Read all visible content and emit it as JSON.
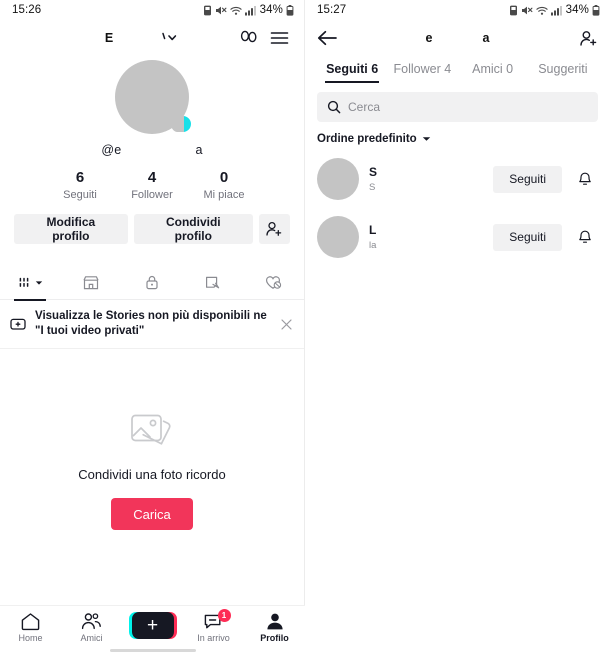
{
  "left": {
    "status": {
      "time": "15:26",
      "battery_percent": "34%"
    },
    "header": {
      "title": "E",
      "caret_icon": "chevron-down-icon",
      "figures_icon": "figures-icon",
      "menu_icon": "hamburger-menu-icon"
    },
    "profile": {
      "handle_prefix": "@e",
      "handle_suffix": "a",
      "avatar_badge_color": "#18e0e8"
    },
    "stats": [
      {
        "value": "6",
        "label": "Seguiti"
      },
      {
        "value": "4",
        "label": "Follower"
      },
      {
        "value": "0",
        "label": "Mi piace"
      }
    ],
    "actions": {
      "edit_label": "Modifica profilo",
      "share_label": "Condividi profilo",
      "add_friend_icon": "add-person-icon"
    },
    "tabs": [
      {
        "icon": "grid-posts-icon",
        "active": true,
        "has_caret": true
      },
      {
        "icon": "storefront-icon",
        "active": false,
        "has_caret": false
      },
      {
        "icon": "lock-private-icon",
        "active": false,
        "has_caret": false
      },
      {
        "icon": "repost-icon",
        "active": false,
        "has_caret": false
      },
      {
        "icon": "heart-hidden-icon",
        "active": false,
        "has_caret": false
      }
    ],
    "tip": {
      "icon": "stories-add-icon",
      "text": "Visualizza le Stories non più disponibili ne \"I tuoi video privati\"",
      "close_icon": "close-icon"
    },
    "empty": {
      "icon": "photo-stack-icon",
      "title": "Condividi una foto ricordo",
      "button_label": "Carica",
      "button_color": "#f2355a"
    },
    "bottomnav": [
      {
        "icon": "home-icon",
        "label": "Home",
        "active": false
      },
      {
        "icon": "friends-icon",
        "label": "Amici",
        "active": false
      },
      {
        "icon": "plus-icon",
        "label": "",
        "active": false
      },
      {
        "icon": "inbox-icon",
        "label": "In arrivo",
        "active": false,
        "badge": "1"
      },
      {
        "icon": "profile-icon",
        "label": "Profilo",
        "active": true
      }
    ]
  },
  "right": {
    "status": {
      "time": "15:27",
      "battery_percent": "34%"
    },
    "header": {
      "back_icon": "back-arrow-icon",
      "title_part1": "e",
      "title_part2": "a",
      "add_icon": "add-person-icon"
    },
    "segtabs": [
      {
        "label": "Seguiti 6",
        "active": true
      },
      {
        "label": "Follower 4",
        "active": false
      },
      {
        "label": "Amici 0",
        "active": false
      },
      {
        "label": "Suggeriti",
        "active": false
      }
    ],
    "search": {
      "icon": "search-icon",
      "placeholder": "Cerca",
      "value": ""
    },
    "order": {
      "label": "Ordine predefinito",
      "caret_icon": "chevron-down-icon"
    },
    "users": [
      {
        "name": "S",
        "sub": "S",
        "button_label": "Seguiti",
        "bell_icon": "bell-icon"
      },
      {
        "name": "L",
        "sub": "la",
        "button_label": "Seguiti",
        "bell_icon": "bell-icon"
      }
    ]
  }
}
